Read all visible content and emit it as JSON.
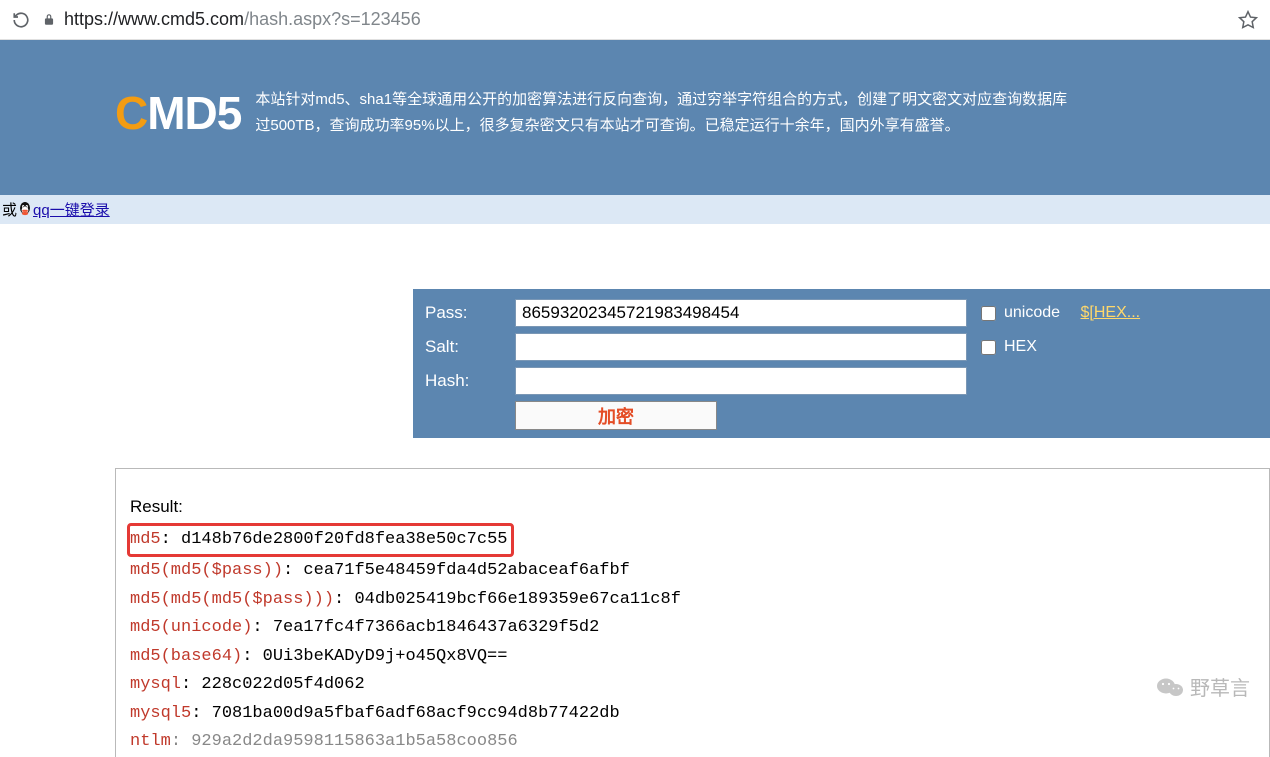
{
  "browser": {
    "url_host": "https://www.cmd5.com",
    "url_path": "/hash.aspx?s=123456"
  },
  "header": {
    "logo_c": "C",
    "logo_rest": "MD5",
    "desc_line1": "本站针对md5、sha1等全球通用公开的加密算法进行反向查询，通过穷举字符组合的方式，创建了明文密文对应查询数据库",
    "desc_line2": "过500TB，查询成功率95%以上，很多复杂密文只有本站才可查询。已稳定运行十余年，国内外享有盛誉。"
  },
  "login": {
    "prefix": "或",
    "link_text": "qq一键登录"
  },
  "form": {
    "pass_label": "Pass:",
    "pass_value": "8659320234572198349845­4",
    "salt_label": "Salt:",
    "salt_value": "",
    "hash_label": "Hash:",
    "hash_value": "",
    "unicode_label": "unicode",
    "hex_link": "$[HEX...",
    "hex_label": "HEX",
    "encrypt_button": "加密"
  },
  "result": {
    "title": "Result:",
    "lines": [
      {
        "alg": "md5",
        "val": "d148b76de2800f20fd8fea38e50c7c55",
        "highlight": true
      },
      {
        "alg": "md5(md5($pass))",
        "val": "cea71f5e48459fda4d52abaceaf6afbf"
      },
      {
        "alg": "md5(md5(md5($pass)))",
        "val": "04db025419bcf66e189359e67ca11c8f"
      },
      {
        "alg": "md5(unicode)",
        "val": "7ea17fc4f7366acb1846437a6329f5d2"
      },
      {
        "alg": "md5(base64)",
        "val": "0Ui3beKADyD9j+o45Qx8VQ=="
      },
      {
        "alg": "mysql",
        "val": "228c022d05f4d062"
      },
      {
        "alg": "mysql5",
        "val": "7081ba00d9a5fbaf6adf68acf9cc94d8b77422db"
      },
      {
        "alg": "ntlm",
        "val": "929a2d2da9598115863a1b5a58coo856",
        "truncated": true
      }
    ]
  },
  "watermark": "野草言"
}
